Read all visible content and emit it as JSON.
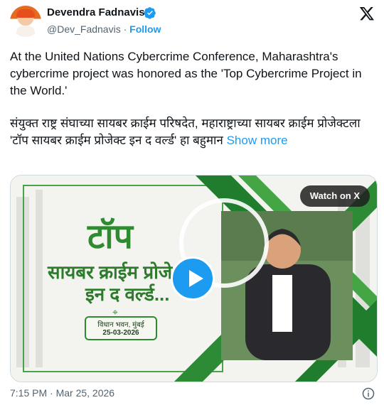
{
  "header": {
    "name": "Devendra Fadnavis",
    "handle": "@Dev_Fadnavis",
    "separator": " · ",
    "follow_label": "Follow"
  },
  "tweet": {
    "text_en": "At the United Nations Cybercrime Conference, Maharashtra's cybercrime project was honored as the 'Top Cybercrime Project in the World.'",
    "text_mr": "संयुक्त राष्ट्र संघाच्या सायबर क्राईम परिषदेत, महाराष्ट्राच्या सायबर क्राईम प्रोजेक्टला 'टॉप सायबर क्राईम प्रोजेक्ट इन द वर्ल्ड' हा बहुमान",
    "show_more": "Show more"
  },
  "media": {
    "watch_label": "Watch on X",
    "headline_line1": "टॉप",
    "headline_line2": "सायबर क्राईम प्रोजे",
    "headline_line3": "इन द वर्ल्ड...",
    "venue_line1": "विधान भवन, मुंबई",
    "venue_line2": "25-03-2026",
    "accent_color": "#2e8b2f",
    "play_color": "#1d9bf0"
  },
  "footer": {
    "timestamp": "7:15 PM · Mar 25, 2026"
  }
}
